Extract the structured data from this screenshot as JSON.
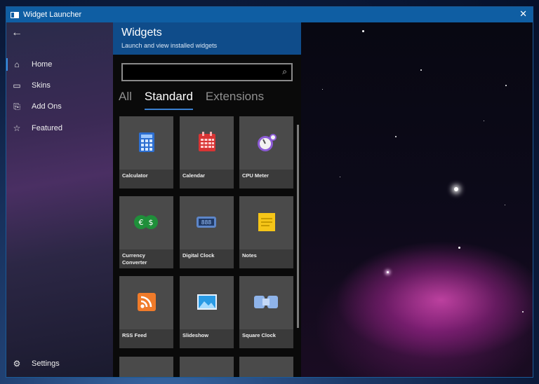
{
  "window": {
    "title": "Widget Launcher"
  },
  "sidebar": {
    "items": [
      {
        "label": "Home",
        "icon": "home-icon"
      },
      {
        "label": "Skins",
        "icon": "skins-icon"
      },
      {
        "label": "Add Ons",
        "icon": "add-ons-icon"
      },
      {
        "label": "Featured",
        "icon": "star-icon"
      }
    ],
    "settings_label": "Settings"
  },
  "panel": {
    "title": "Widgets",
    "subtitle": "Launch and view installed widgets",
    "search_value": ""
  },
  "tabs": [
    "All",
    "Standard",
    "Extensions"
  ],
  "active_tab": "Standard",
  "widgets": [
    {
      "label": "Calculator",
      "icon": "calculator-icon"
    },
    {
      "label": "Calendar",
      "icon": "calendar-icon"
    },
    {
      "label": "CPU Meter",
      "icon": "cpu-meter-icon"
    },
    {
      "label": "Currency Converter",
      "icon": "currency-converter-icon"
    },
    {
      "label": "Digital Clock",
      "icon": "digital-clock-icon"
    },
    {
      "label": "Notes",
      "icon": "notes-icon"
    },
    {
      "label": "RSS Feed",
      "icon": "rss-feed-icon"
    },
    {
      "label": "Slideshow",
      "icon": "slideshow-icon"
    },
    {
      "label": "Square Clock",
      "icon": "square-clock-icon"
    }
  ],
  "colors": {
    "titlebar": "#0f5ea3",
    "panel_header": "#0f4c8a",
    "accent": "#3a7fcf"
  }
}
